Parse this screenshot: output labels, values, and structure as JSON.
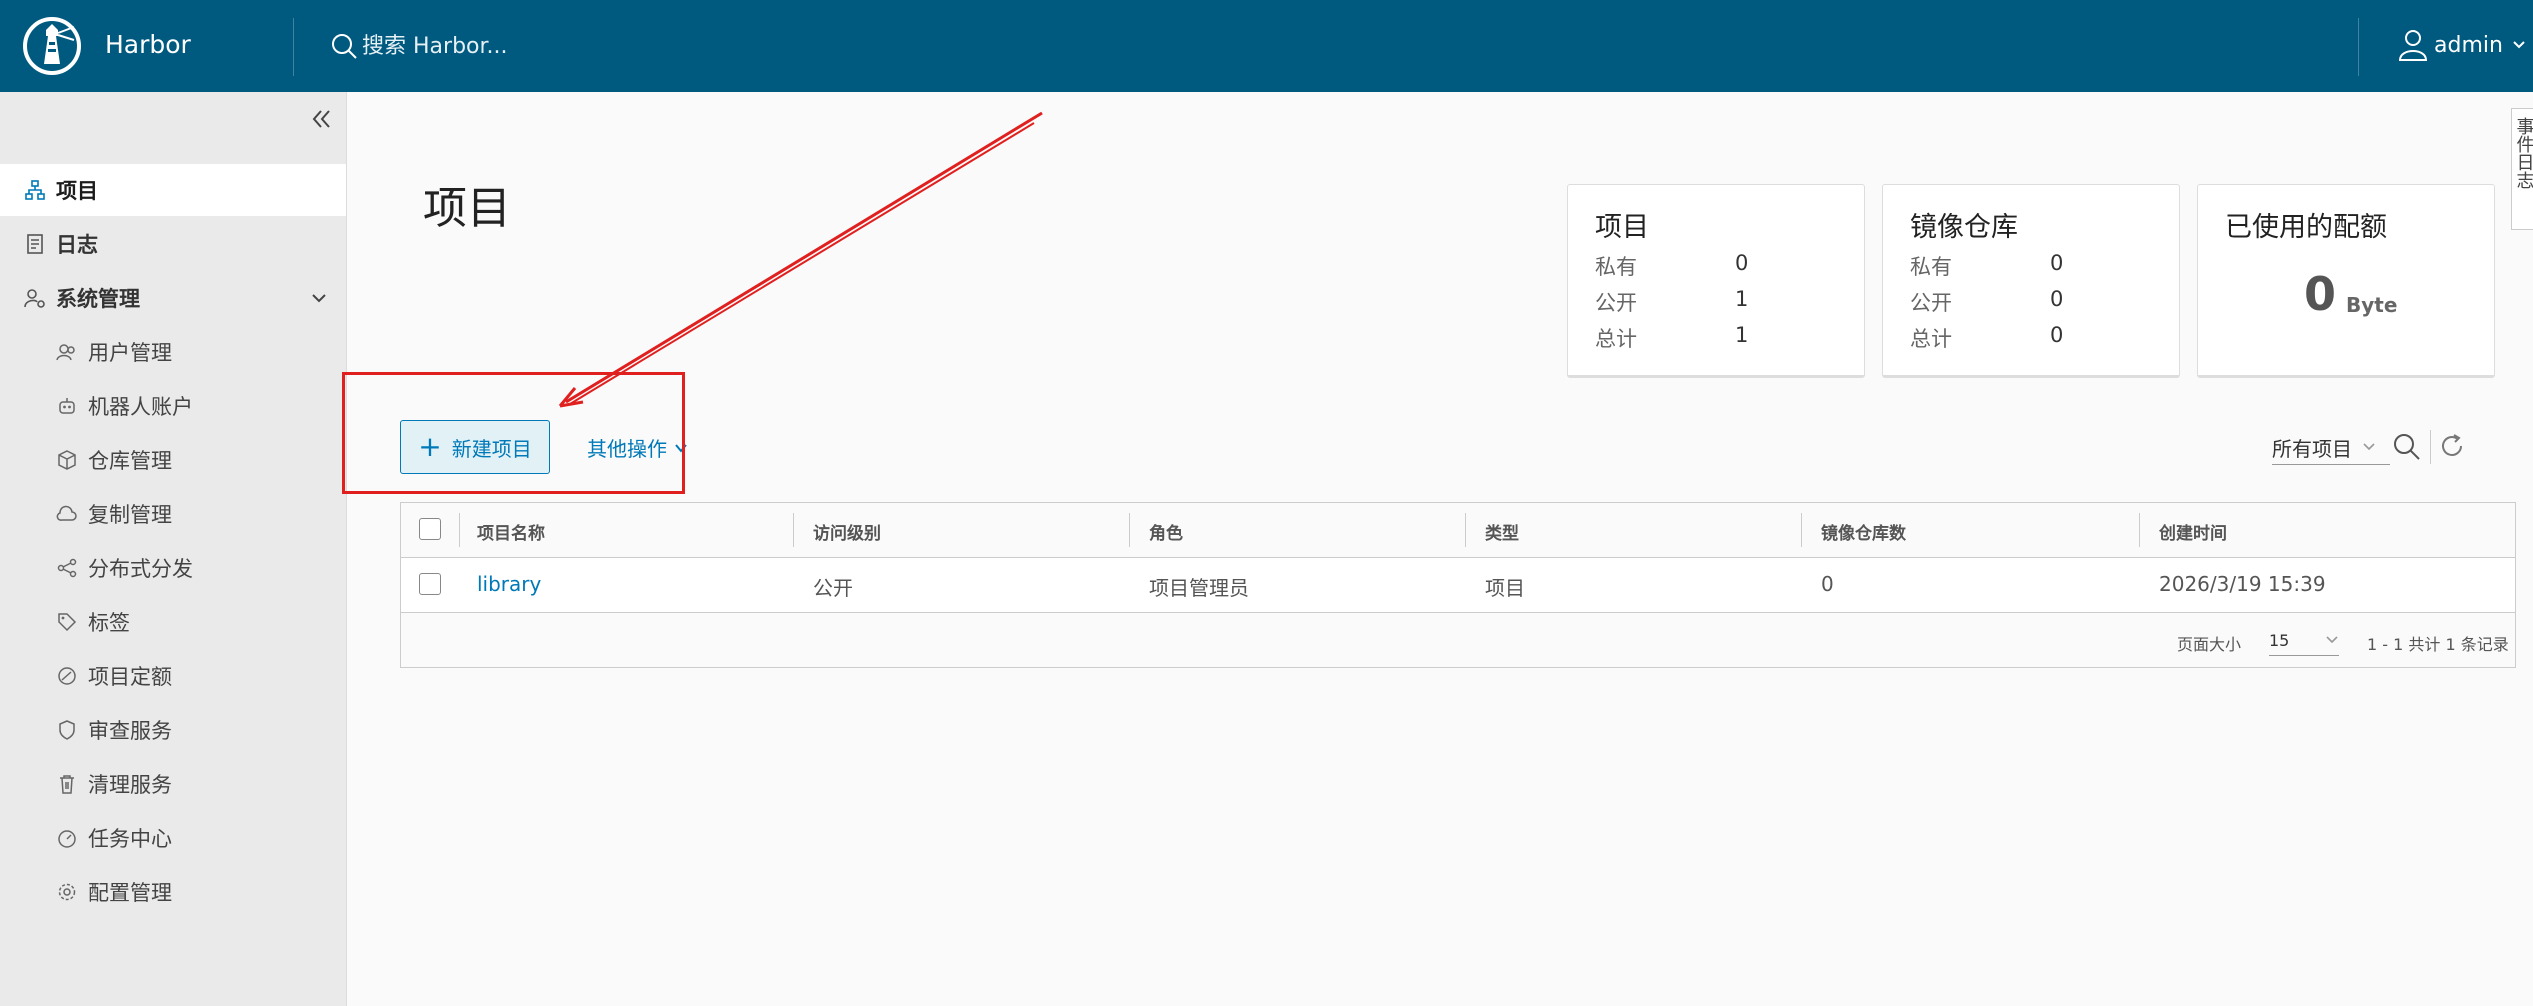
{
  "header": {
    "brand": "Harbor",
    "search_placeholder": "搜索 Harbor...",
    "user": "admin",
    "bg_color": "#005a80"
  },
  "sidebar": {
    "items": [
      {
        "label": "项目",
        "icon": "project-icon",
        "active": true
      },
      {
        "label": "日志",
        "icon": "log-icon"
      },
      {
        "label": "系统管理",
        "icon": "admin-gear-icon",
        "expanded": true
      }
    ],
    "sub_items": [
      {
        "label": "用户管理",
        "icon": "users-icon"
      },
      {
        "label": "机器人账户",
        "icon": "robot-icon"
      },
      {
        "label": "仓库管理",
        "icon": "box-icon"
      },
      {
        "label": "复制管理",
        "icon": "cloud-sync-icon"
      },
      {
        "label": "分布式分发",
        "icon": "share-icon"
      },
      {
        "label": "标签",
        "icon": "tag-icon"
      },
      {
        "label": "项目定额",
        "icon": "dashboard-icon"
      },
      {
        "label": "审查服务",
        "icon": "shield-icon"
      },
      {
        "label": "清理服务",
        "icon": "trash-icon"
      },
      {
        "label": "任务中心",
        "icon": "speedometer-icon"
      },
      {
        "label": "配置管理",
        "icon": "settings-icon"
      }
    ]
  },
  "main": {
    "title": "项目",
    "cards": {
      "projects": {
        "title": "项目",
        "rows": [
          {
            "label": "私有",
            "value": "0"
          },
          {
            "label": "公开",
            "value": "1"
          },
          {
            "label": "总计",
            "value": "1"
          }
        ]
      },
      "repos": {
        "title": "镜像仓库",
        "rows": [
          {
            "label": "私有",
            "value": "0"
          },
          {
            "label": "公开",
            "value": "0"
          },
          {
            "label": "总计",
            "value": "0"
          }
        ]
      },
      "quota": {
        "title": "已使用的配额",
        "value": "0",
        "unit": "Byte"
      }
    },
    "toolbar": {
      "new_project": "新建项目",
      "more_actions": "其他操作",
      "filter": "所有项目"
    },
    "table": {
      "columns": [
        "项目名称",
        "访问级别",
        "角色",
        "类型",
        "镜像仓库数",
        "创建时间"
      ],
      "rows": [
        {
          "name": "library",
          "access": "公开",
          "role": "项目管理员",
          "type": "项目",
          "repo_count": "0",
          "created": "2026/3/19 15:39"
        }
      ],
      "footer": {
        "page_size_label": "页面大小",
        "page_size": "15",
        "count": "1 - 1 共计 1 条记录"
      }
    },
    "side_tab": "事件日志"
  },
  "accent_color": "#0079b8",
  "annotation_color": "#e0201f"
}
